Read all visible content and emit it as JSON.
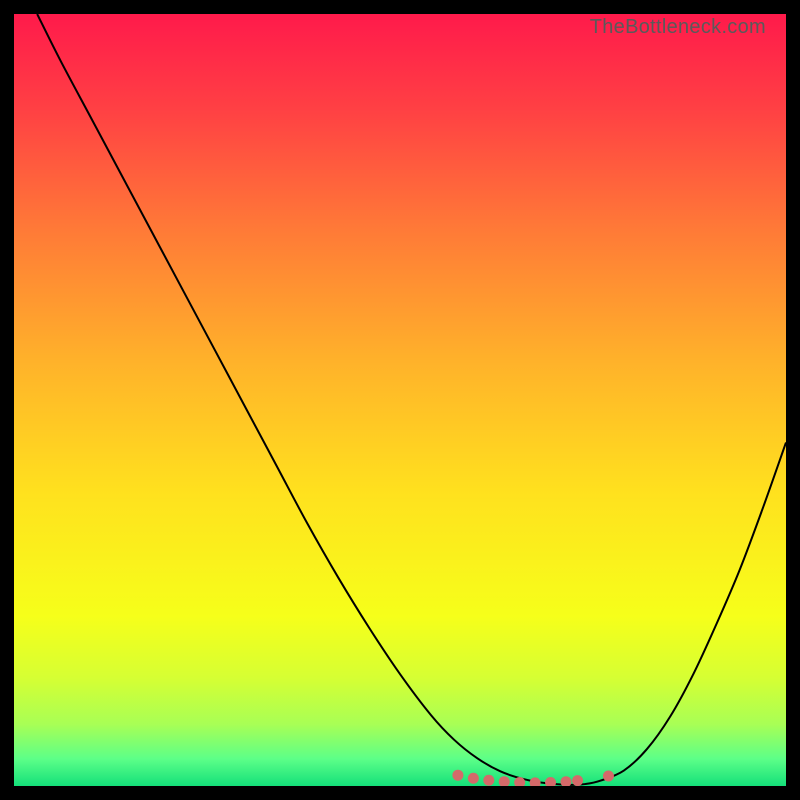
{
  "watermark": "TheBottleneck.com",
  "chart_data": {
    "type": "line",
    "title": "",
    "xlabel": "",
    "ylabel": "",
    "xlim": [
      0,
      100
    ],
    "ylim": [
      0,
      100
    ],
    "background_gradient": {
      "stops": [
        {
          "offset": 0.0,
          "color": "#ff1a4b"
        },
        {
          "offset": 0.12,
          "color": "#ff3f44"
        },
        {
          "offset": 0.28,
          "color": "#ff7a37"
        },
        {
          "offset": 0.45,
          "color": "#ffb22a"
        },
        {
          "offset": 0.62,
          "color": "#ffe11e"
        },
        {
          "offset": 0.78,
          "color": "#f6ff1a"
        },
        {
          "offset": 0.86,
          "color": "#d6ff33"
        },
        {
          "offset": 0.92,
          "color": "#a8ff55"
        },
        {
          "offset": 0.965,
          "color": "#5cff88"
        },
        {
          "offset": 1.0,
          "color": "#14e07a"
        }
      ]
    },
    "series": [
      {
        "name": "bottleneck-curve",
        "color": "#000000",
        "width": 2.0,
        "x": [
          3,
          6,
          10,
          14,
          18,
          22,
          26,
          30,
          34,
          38,
          42,
          46,
          50,
          54,
          57,
          60,
          63,
          66,
          69,
          72,
          74,
          76,
          79,
          82,
          85,
          88,
          91,
          94,
          97,
          100
        ],
        "y": [
          100,
          94,
          86.5,
          79,
          71.5,
          64,
          56.5,
          49,
          41.5,
          34,
          27,
          20.5,
          14.5,
          9.2,
          6.0,
          3.6,
          1.9,
          0.9,
          0.35,
          0.15,
          0.25,
          0.7,
          2.0,
          4.8,
          9.0,
          14.5,
          21.0,
          28.0,
          36.0,
          44.5
        ]
      }
    ],
    "markers": {
      "name": "sweet-spot",
      "color": "#d46a6a",
      "radius": 5.5,
      "points": [
        {
          "x": 57.5,
          "y": 1.4
        },
        {
          "x": 59.5,
          "y": 1.0
        },
        {
          "x": 61.5,
          "y": 0.75
        },
        {
          "x": 63.5,
          "y": 0.55
        },
        {
          "x": 65.5,
          "y": 0.45
        },
        {
          "x": 67.5,
          "y": 0.4
        },
        {
          "x": 69.5,
          "y": 0.45
        },
        {
          "x": 71.5,
          "y": 0.55
        },
        {
          "x": 73.0,
          "y": 0.7
        },
        {
          "x": 77.0,
          "y": 1.3
        }
      ]
    }
  }
}
